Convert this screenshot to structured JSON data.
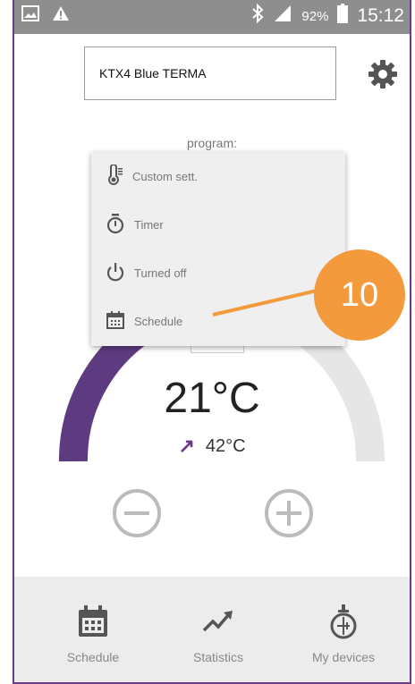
{
  "statusbar": {
    "battery_percent": "92%",
    "time": "15:12",
    "icons": [
      "image-icon",
      "warning-icon",
      "bluetooth-icon",
      "signal-icon",
      "battery-icon"
    ]
  },
  "header": {
    "device_name": "KTX4 Blue TERMA",
    "settings_icon": "gear-icon"
  },
  "program": {
    "label": "program:"
  },
  "menu": {
    "items": [
      {
        "label": "Custom sett.",
        "icon": "thermometer-icon"
      },
      {
        "label": "Timer",
        "icon": "stopwatch-icon"
      },
      {
        "label": "Turned off",
        "icon": "power-icon"
      },
      {
        "label": "Schedule",
        "icon": "calendar-icon"
      }
    ]
  },
  "annotation": {
    "number": "10"
  },
  "thermostat": {
    "current_temp": "21°C",
    "target_temp": "42°C",
    "arrow": "↗",
    "level_fraction": 0.33,
    "accent_color": "#5e3a80"
  },
  "controls": {
    "minus_icon": "minus-circle-icon",
    "plus_icon": "plus-circle-icon"
  },
  "bottom_nav": {
    "items": [
      {
        "label": "Schedule",
        "icon": "calendar-icon"
      },
      {
        "label": "Statistics",
        "icon": "chart-icon"
      },
      {
        "label": "My devices",
        "icon": "device-icon"
      }
    ]
  }
}
